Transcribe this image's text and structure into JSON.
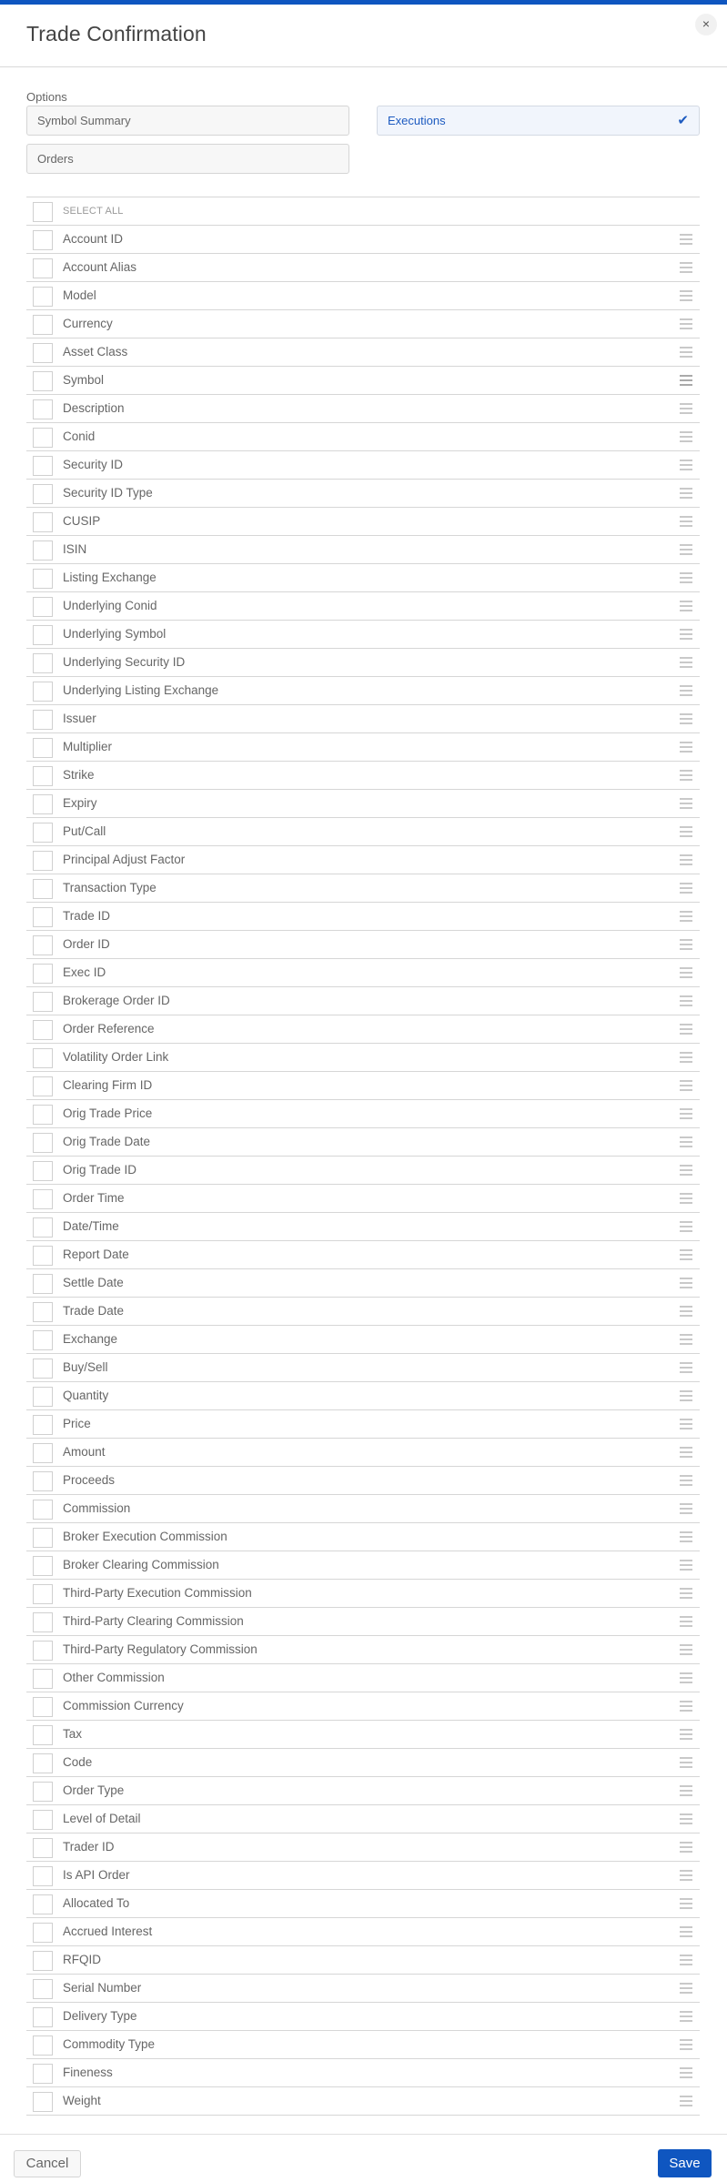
{
  "dialog": {
    "title": "Trade Confirmation",
    "close_icon": "×"
  },
  "options": {
    "label": "Options",
    "items": [
      {
        "label": "Symbol Summary",
        "selected": false
      },
      {
        "label": "Executions",
        "selected": true
      },
      {
        "label": "Orders",
        "selected": false
      }
    ],
    "check_icon": "✔"
  },
  "fields": {
    "select_all_label": "SELECT ALL",
    "items": [
      "Account ID",
      "Account Alias",
      "Model",
      "Currency",
      "Asset Class",
      "Symbol",
      "Description",
      "Conid",
      "Security ID",
      "Security ID Type",
      "CUSIP",
      "ISIN",
      "Listing Exchange",
      "Underlying Conid",
      "Underlying Symbol",
      "Underlying Security ID",
      "Underlying Listing Exchange",
      "Issuer",
      "Multiplier",
      "Strike",
      "Expiry",
      "Put/Call",
      "Principal Adjust Factor",
      "Transaction Type",
      "Trade ID",
      "Order ID",
      "Exec ID",
      "Brokerage Order ID",
      "Order Reference",
      "Volatility Order Link",
      "Clearing Firm ID",
      "Orig Trade Price",
      "Orig Trade Date",
      "Orig Trade ID",
      "Order Time",
      "Date/Time",
      "Report Date",
      "Settle Date",
      "Trade Date",
      "Exchange",
      "Buy/Sell",
      "Quantity",
      "Price",
      "Amount",
      "Proceeds",
      "Commission",
      "Broker Execution Commission",
      "Broker Clearing Commission",
      "Third-Party Execution Commission",
      "Third-Party Clearing Commission",
      "Third-Party Regulatory Commission",
      "Other Commission",
      "Commission Currency",
      "Tax",
      "Code",
      "Order Type",
      "Level of Detail",
      "Trader ID",
      "Is API Order",
      "Allocated To",
      "Accrued Interest",
      "RFQID",
      "Serial Number",
      "Delivery Type",
      "Commodity Type",
      "Fineness",
      "Weight"
    ]
  },
  "footer": {
    "cancel_label": "Cancel",
    "save_label": "Save"
  },
  "colors": {
    "accent": "#0f56c0",
    "selected_bg": "#f1f5fc"
  }
}
